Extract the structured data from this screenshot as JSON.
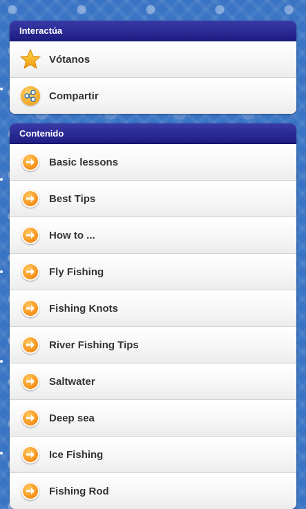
{
  "interact_panel": {
    "header": "Interactúa",
    "items": [
      {
        "label": "Vótanos",
        "icon": "star-icon"
      },
      {
        "label": "Compartir",
        "icon": "share-icon"
      }
    ]
  },
  "content_panel": {
    "header": "Contenido",
    "items": [
      {
        "label": "Basic lessons",
        "icon": "arrow-right-icon"
      },
      {
        "label": "Best Tips",
        "icon": "arrow-right-icon"
      },
      {
        "label": "How to ...",
        "icon": "arrow-right-icon"
      },
      {
        "label": "Fly Fishing",
        "icon": "arrow-right-icon"
      },
      {
        "label": "Fishing Knots",
        "icon": "arrow-right-icon"
      },
      {
        "label": "River Fishing Tips",
        "icon": "arrow-right-icon"
      },
      {
        "label": "Saltwater",
        "icon": "arrow-right-icon"
      },
      {
        "label": "Deep sea",
        "icon": "arrow-right-icon"
      },
      {
        "label": "Ice Fishing",
        "icon": "arrow-right-icon"
      },
      {
        "label": "Fishing Rod",
        "icon": "arrow-right-icon"
      }
    ]
  },
  "colors": {
    "background": "#3a74c4",
    "header": "#24248f",
    "accent": "#f7941d"
  }
}
